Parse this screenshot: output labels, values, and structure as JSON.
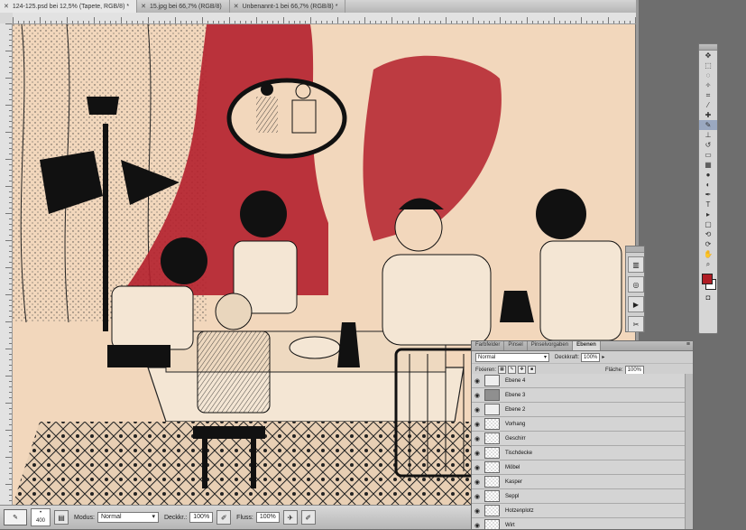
{
  "tabs": [
    {
      "label": "124-125.psd bei 12,5% (Tapete, RGB/8) *",
      "active": true
    },
    {
      "label": "15.jpg bei 66,7% (RGB/8)",
      "active": false
    },
    {
      "label": "Unbenannt-1 bei 66,7% (RGB/8) *",
      "active": false
    }
  ],
  "options": {
    "brush_size": "400",
    "mode_label": "Modus:",
    "mode_value": "Normal",
    "opacity_label": "Deckkr.:",
    "opacity_value": "100%",
    "flow_label": "Fluss:",
    "flow_value": "100%"
  },
  "layers_panel": {
    "tabs": [
      "Farbfelder",
      "Pinsel",
      "Pinselvorgaben",
      "Ebenen"
    ],
    "active_tab": "Ebenen",
    "blend_mode": "Normal",
    "opacity_label": "Deckkraft:",
    "opacity_value": "100%",
    "lock_label": "Fixieren:",
    "fill_label": "Fläche:",
    "fill_value": "100%",
    "layers": [
      {
        "name": "Ebene 4",
        "thumb": "sketch"
      },
      {
        "name": "Ebene 3",
        "thumb": "gray"
      },
      {
        "name": "Ebene 2",
        "thumb": "sketch"
      },
      {
        "name": "Vorhang",
        "thumb": "transparent"
      },
      {
        "name": "Geschirr",
        "thumb": "transparent"
      },
      {
        "name": "Tischdecke",
        "thumb": "transparent"
      },
      {
        "name": "Möbel",
        "thumb": "transparent"
      },
      {
        "name": "Kasper",
        "thumb": "transparent"
      },
      {
        "name": "Seppl",
        "thumb": "transparent"
      },
      {
        "name": "Hotzenplotz",
        "thumb": "transparent"
      },
      {
        "name": "Wirt",
        "thumb": "transparent"
      }
    ]
  },
  "colors": {
    "foreground": "#b01c24",
    "background": "#ffffff",
    "canvas_paper": "#f2d7bc",
    "curtain_red": "#b4202c"
  }
}
